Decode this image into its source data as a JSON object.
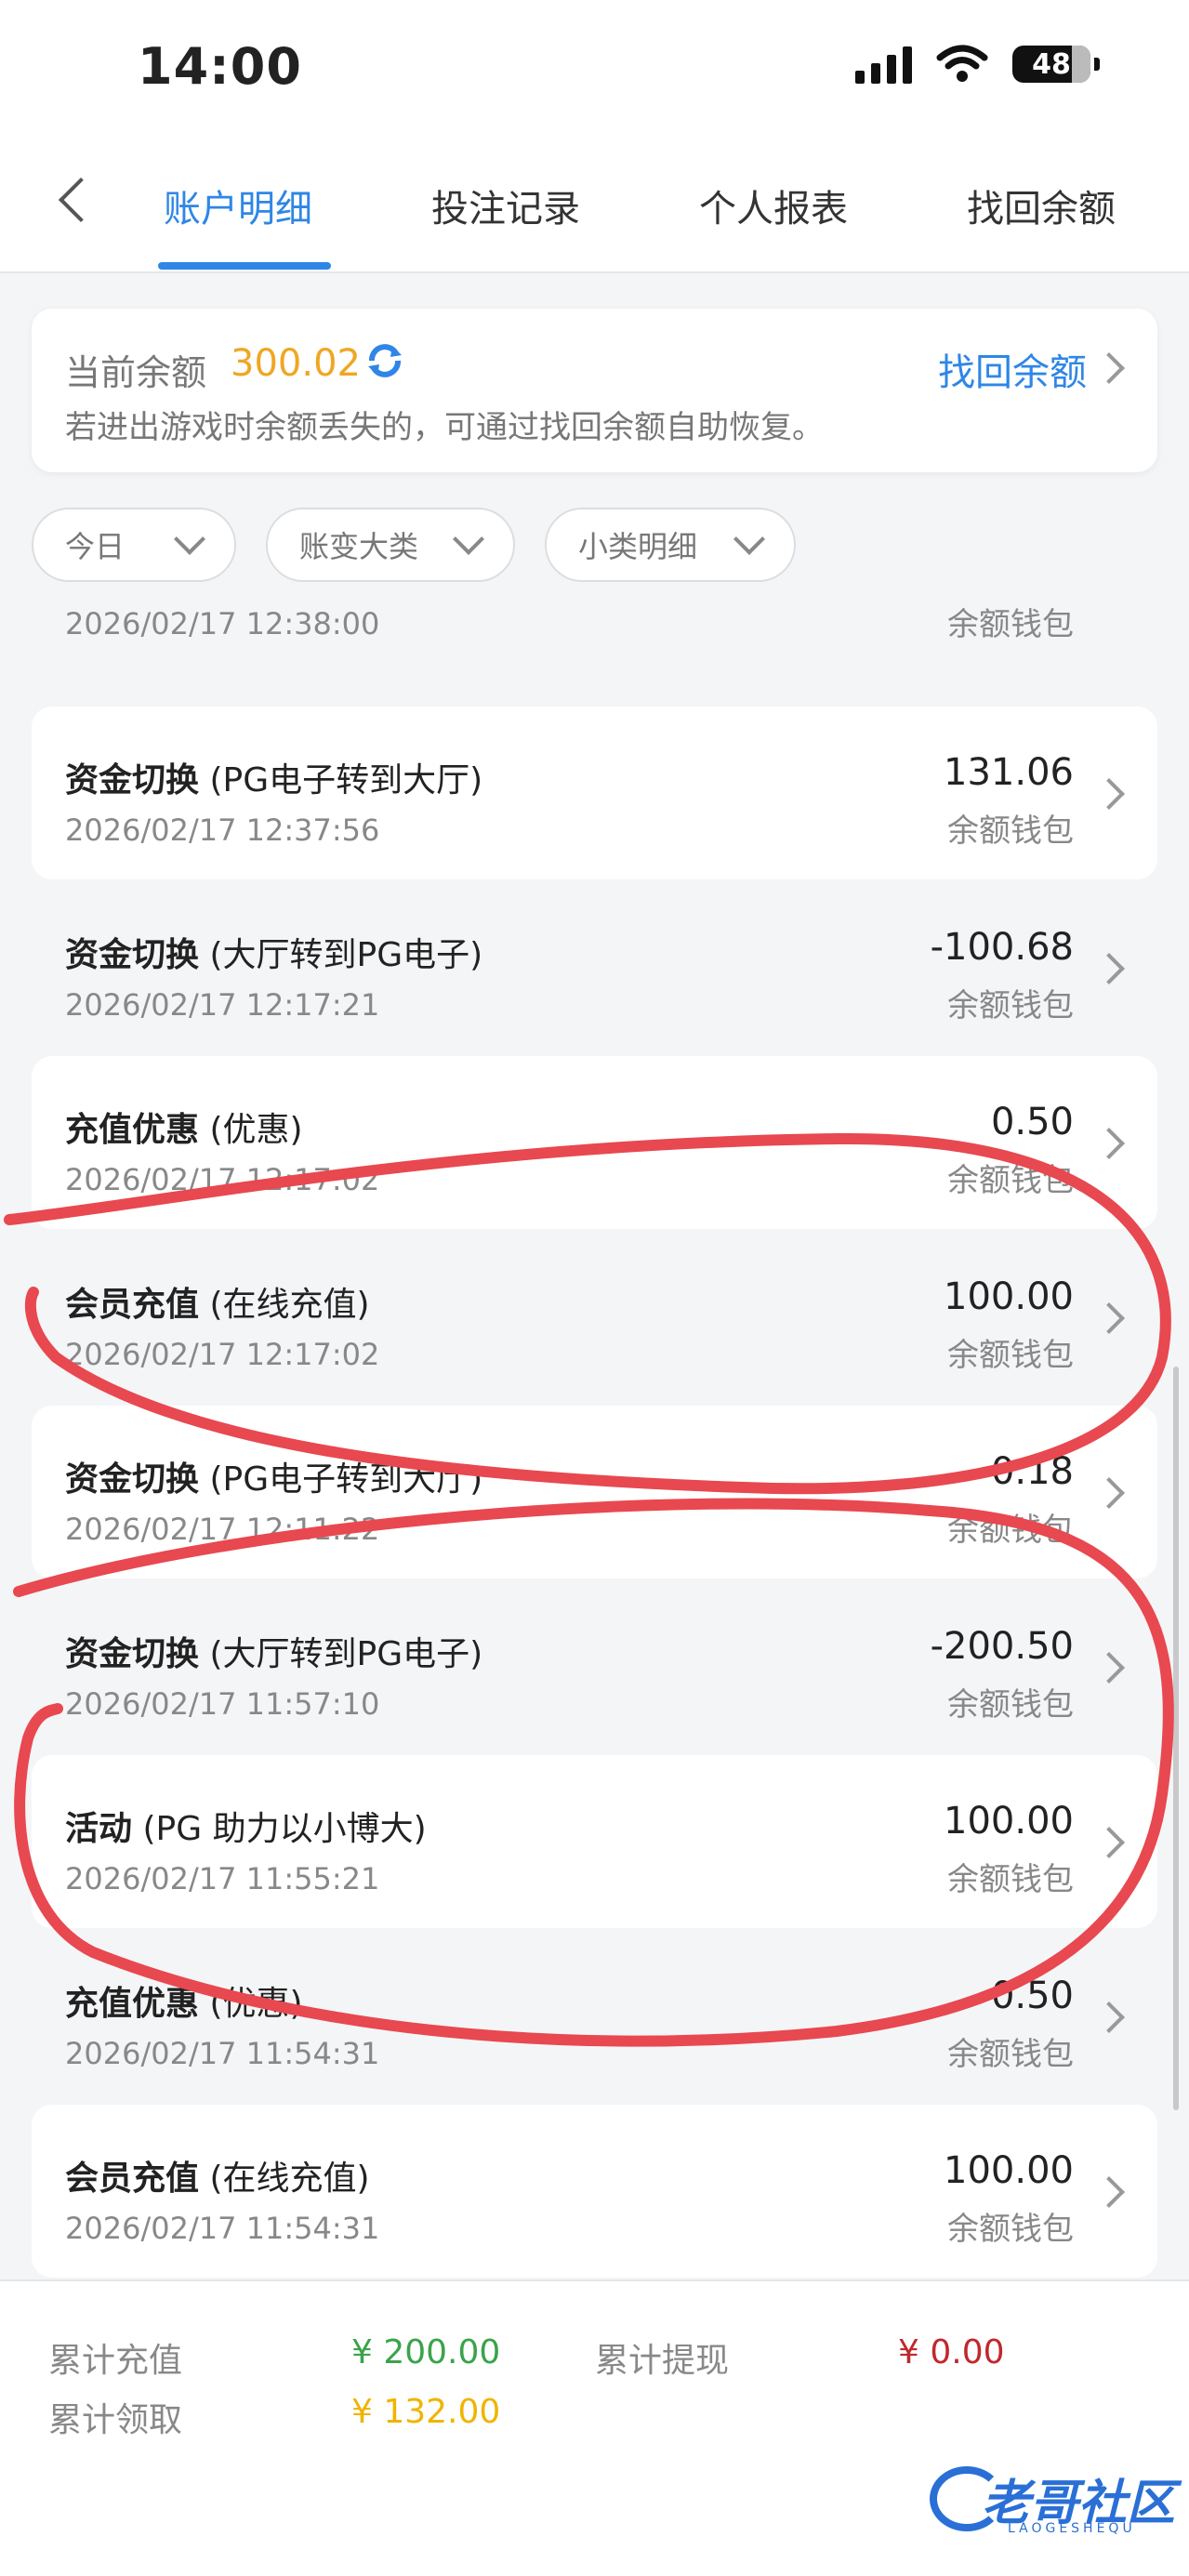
{
  "status_bar": {
    "time": "14:00",
    "battery": "48"
  },
  "tabs": [
    {
      "label": "账户明细",
      "active": true
    },
    {
      "label": "投注记录",
      "active": false
    },
    {
      "label": "个人报表",
      "active": false
    },
    {
      "label": "找回余额",
      "active": false
    }
  ],
  "balance": {
    "label": "当前余额",
    "amount": "300.02",
    "note": "若进出游戏时余额丢失的，可通过找回余额自助恢复。",
    "recover_label": "找回余额"
  },
  "filters": [
    {
      "label": "今日"
    },
    {
      "label": "账变大类"
    },
    {
      "label": "小类明细"
    }
  ],
  "transactions": [
    {
      "type": "",
      "detail": "",
      "time": "2026/02/17 12:38:00",
      "amount": "",
      "wallet": "余额钱包"
    },
    {
      "type": "资金切换",
      "detail": "(PG电子转到大厅)",
      "time": "2026/02/17 12:37:56",
      "amount": "131.06",
      "wallet": "余额钱包"
    },
    {
      "type": "资金切换",
      "detail": "(大厅转到PG电子)",
      "time": "2026/02/17 12:17:21",
      "amount": "-100.68",
      "wallet": "余额钱包"
    },
    {
      "type": "充值优惠",
      "detail": "(优惠)",
      "time": "2026/02/17 12:17:02",
      "amount": "0.50",
      "wallet": "余额钱包"
    },
    {
      "type": "会员充值",
      "detail": "(在线充值)",
      "time": "2026/02/17 12:17:02",
      "amount": "100.00",
      "wallet": "余额钱包"
    },
    {
      "type": "资金切换",
      "detail": "(PG电子转到大厅)",
      "time": "2026/02/17 12:11:22",
      "amount": "0.18",
      "wallet": "余额钱包"
    },
    {
      "type": "资金切换",
      "detail": "(大厅转到PG电子)",
      "time": "2026/02/17 11:57:10",
      "amount": "-200.50",
      "wallet": "余额钱包"
    },
    {
      "type": "活动",
      "detail": "(PG 助力以小博大)",
      "time": "2026/02/17 11:55:21",
      "amount": "100.00",
      "wallet": "余额钱包"
    },
    {
      "type": "充值优惠",
      "detail": "(优惠)",
      "time": "2026/02/17 11:54:31",
      "amount": "0.50",
      "wallet": "余额钱包"
    },
    {
      "type": "会员充值",
      "detail": "(在线充值)",
      "time": "2026/02/17 11:54:31",
      "amount": "100.00",
      "wallet": "余额钱包"
    }
  ],
  "summary": {
    "total_recharge_label": "累计充值",
    "total_recharge": "¥ 200.00",
    "total_withdraw_label": "累计提现",
    "total_withdraw": "¥ 0.00",
    "total_claimed_label": "累计领取",
    "total_claimed": "¥ 132.00"
  },
  "watermark": {
    "text": "老哥社区",
    "sub": "LAOGESHEQU"
  },
  "colors": {
    "accent": "#2f86e6",
    "balance": "#f0a623",
    "recharge": "#3aa34a",
    "withdraw": "#c0282d",
    "claimed": "#f0b400",
    "annotation": "#e8484f"
  }
}
